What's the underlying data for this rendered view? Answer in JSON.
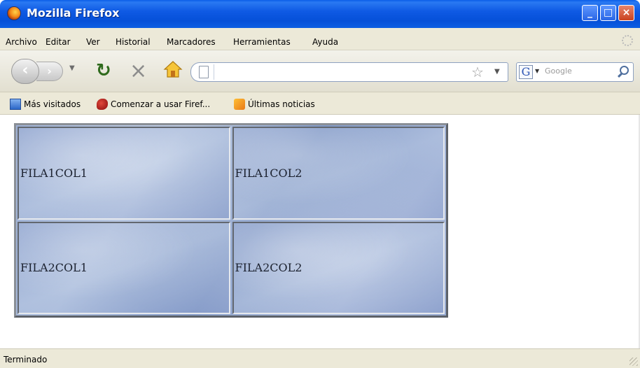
{
  "window": {
    "title": "Mozilla Firefox",
    "minimize_icon": "minimize-icon",
    "maximize_icon": "maximize-icon",
    "close_icon": "close-icon"
  },
  "menu": {
    "items": [
      "Archivo",
      "Editar",
      "Ver",
      "Historial",
      "Marcadores",
      "Herramientas",
      "Ayuda"
    ]
  },
  "navigation": {
    "url_value": "",
    "search_placeholder": "Google",
    "search_engine_letter": "G"
  },
  "bookmarks": {
    "items": [
      {
        "label": "Más visitados",
        "icon": "most-visited-icon"
      },
      {
        "label": "Comenzar a usar Firef...",
        "icon": "getting-started-icon"
      },
      {
        "label": "Últimas noticias",
        "icon": "rss-feed-icon"
      }
    ]
  },
  "table": {
    "rows": [
      [
        "FILA1COL1",
        "FILA1COL2"
      ],
      [
        "FILA2COL1",
        "FILA2COL2"
      ]
    ]
  },
  "status": {
    "text": "Terminado"
  },
  "colors": {
    "titlebar": "#0f5ae4",
    "chrome": "#ece9d8",
    "table_fill": "#8fa5cf"
  }
}
